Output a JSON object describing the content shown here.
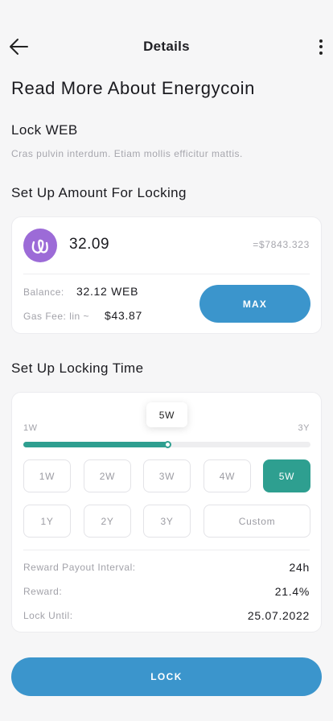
{
  "header": {
    "title": "Details",
    "back_icon": "arrow-left-icon",
    "more_icon": "more-vertical-icon"
  },
  "page_title": "Read More About Energycoin",
  "lock_section": {
    "title": "Lock WEB",
    "description": "Cras pulvin interdum. Etiam mollis efficitur mattis."
  },
  "amount_section": {
    "title": "Set Up Amount For Locking",
    "coin_icon": "energycoin-icon",
    "amount": "32.09",
    "usd_value": "=$7843.323",
    "balance_label": "Balance:",
    "balance_value": "32.12 WEB",
    "gas_label": "Gas Fee: lin ~",
    "gas_value": "$43.87",
    "max_label": "MAX"
  },
  "time_section": {
    "title": "Set Up Locking Time",
    "tooltip": "5W",
    "min_label": "1W",
    "max_label": "3Y",
    "slider_fraction": 0.5,
    "options_row1": [
      "1W",
      "2W",
      "3W",
      "4W",
      "5W"
    ],
    "options_row2": [
      "1Y",
      "2Y",
      "3Y",
      "Custom"
    ],
    "selected": "5W",
    "reward_interval_label": "Reward Payout Interval:",
    "reward_interval_value": "24h",
    "reward_label": "Reward:",
    "reward_value": "21.4%",
    "lock_until_label": "Lock Until:",
    "lock_until_value": "25.07.2022"
  },
  "lock_button": "LOCK",
  "colors": {
    "accent_blue": "#3b95cc",
    "accent_teal": "#2e9f90",
    "coin_purple": "#9c6bd7"
  }
}
